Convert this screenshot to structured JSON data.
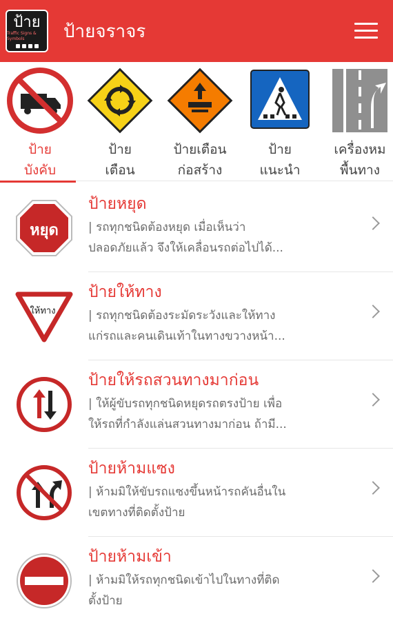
{
  "app": {
    "logo_text": "ป้าย",
    "logo_subtext": "Traffic Signs & Symbols",
    "title": "ป้ายจราจร"
  },
  "categories": [
    {
      "label_line1": "ป้าย",
      "label_line2": "บังคับ",
      "active": true
    },
    {
      "label_line1": "ป้าย",
      "label_line2": "เตือน",
      "active": false
    },
    {
      "label_line1": "ป้ายเตือน",
      "label_line2": "ก่อสร้าง",
      "active": false
    },
    {
      "label_line1": "ป้าย",
      "label_line2": "แนะนำ",
      "active": false
    },
    {
      "label_line1": "เครื่องหม",
      "label_line2": "พื้นทาง",
      "active": false
    }
  ],
  "signs": [
    {
      "title": "ป้ายหยุด",
      "description": "| รถทุกชนิดต้องหยุด เมื่อเห็นว่า\nปลอดภัยแล้ว จึงให้เคลื่อนรถต่อไปได้...",
      "icon_text": "หยุด"
    },
    {
      "title": "ป้ายให้ทาง",
      "description": "| รถทุกชนิดต้องระมัดระวังและให้ทาง\nแก่รถและคนเดินเท้าในทางขวางหน้า...",
      "icon_text": "ให้ทาง"
    },
    {
      "title": "ป้ายให้รถสวนทางมาก่อน",
      "description": "| ให้ผู้ขับรถทุกชนิดหยุดรถตรงป้าย เพื่อ\nให้รถที่กำลังแล่นสวนทางมาก่อน ถ้ามี..."
    },
    {
      "title": "ป้ายห้ามแซง",
      "description": "| ห้ามมิให้ขับรถแซงขึ้นหน้ารถคันอื่นใน\nเขตทางที่ติดตั้งป้าย"
    },
    {
      "title": "ป้ายห้ามเข้า",
      "description": "| ห้ามมิให้รถทุกชนิดเข้าไปในทางที่ติด\nตั้งป้าย"
    }
  ],
  "colors": {
    "primary": "#e53935",
    "sign_red": "#d32f2f",
    "warning_yellow": "#f7d117",
    "construction_orange": "#f57c00",
    "guide_blue": "#1565c0"
  }
}
